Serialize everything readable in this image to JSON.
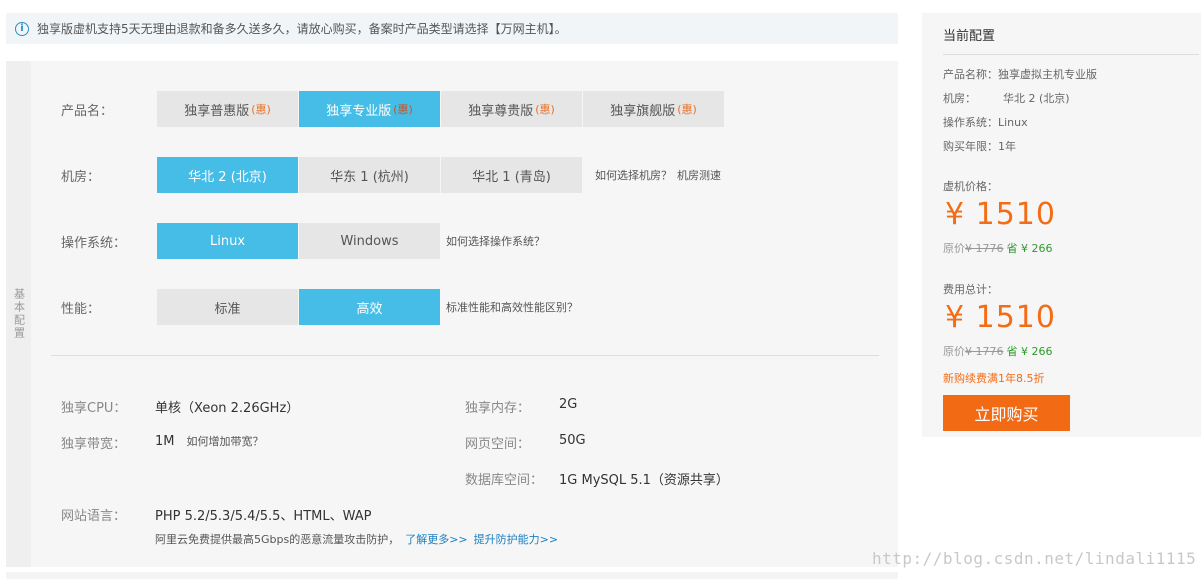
{
  "notice": {
    "icon": "info-icon",
    "text": "独享版虚机支持5天无理由退款和备多久送多久，请放心购买，备案时产品类型请选择【万网主机】。"
  },
  "side_tab": "基本配置",
  "product": {
    "label": "产品名：",
    "badge": "(惠)",
    "options": [
      "独享普惠版",
      "独享专业版",
      "独享尊贵版",
      "独享旗舰版"
    ],
    "selected": 1
  },
  "datacenter": {
    "label": "机房：",
    "options": [
      "华北 2 (北京)",
      "华东 1 (杭州)",
      "华北 1 (青岛)"
    ],
    "selected": 0,
    "help_link": "如何选择机房？",
    "speed_link": "机房测速"
  },
  "os": {
    "label": "操作系统：",
    "options": [
      "Linux",
      "Windows"
    ],
    "selected": 0,
    "help_link": "如何选择操作系统？"
  },
  "performance": {
    "label": "性能：",
    "options": [
      "标准",
      "高效"
    ],
    "selected": 1,
    "help_link": "标准性能和高效性能区别？"
  },
  "specs": {
    "cpu_label": "独享CPU：",
    "cpu_value": "单核（Xeon 2.26GHz）",
    "memory_label": "独享内存：",
    "memory_value": "2G",
    "bandwidth_label": "独享带宽：",
    "bandwidth_value": "1M",
    "bandwidth_link": "如何增加带宽？",
    "webspace_label": "网页空间：",
    "webspace_value": "50G",
    "db_label": "数据库空间：",
    "db_value": "1G MySQL 5.1（资源共享）",
    "lang_label": "网站语言：",
    "lang_value": "PHP 5.2/5.3/5.4/5.5、HTML、WAP",
    "ddos_text": "阿里云免费提供最高5Gbps的恶意流量攻击防护，",
    "ddos_link1": "了解更多>>",
    "ddos_link2": "提升防护能力>>"
  },
  "summary": {
    "title": "当前配置",
    "product_line": "产品名称：独享虚拟主机专业版",
    "room_key": "机房：",
    "room_val": "华北 2 (北京)",
    "os_line": "操作系统：Linux",
    "term_line": "购买年限：1年",
    "vm_price_label": "虚机价格：",
    "vm_price": "¥ 1510",
    "orig_prefix": "原价",
    "orig_price": "¥ 1776",
    "save_text": "省 ¥ 266",
    "total_label": "费用总计：",
    "total_price": "¥ 1510",
    "total_orig_prefix": "原价",
    "total_orig_price": "¥ 1776",
    "total_save_text": "省 ¥ 266",
    "renew_text": "新购续费满1年8.5折",
    "buy_button": "立即购买"
  },
  "watermark": "http://blog.csdn.net/lindali1115",
  "colors": {
    "selected_option": "#45bde6",
    "price": "#f36c16",
    "buy_button": "#f26b14",
    "save": "#2c9b2c"
  }
}
